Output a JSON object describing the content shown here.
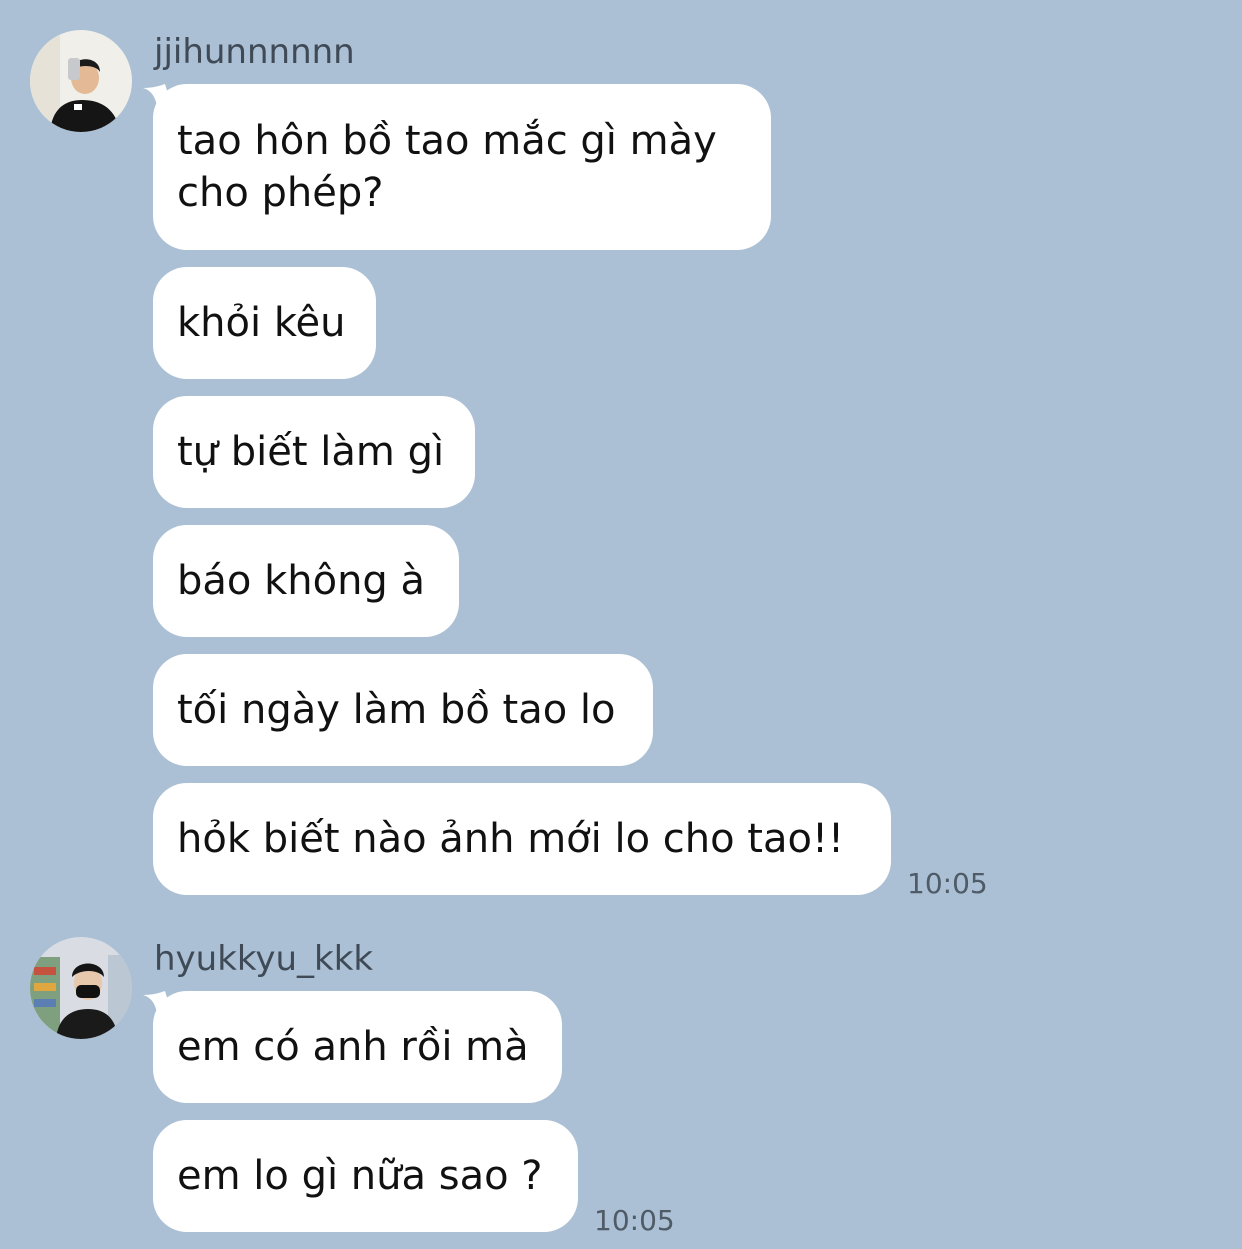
{
  "chat": {
    "groups": [
      {
        "username": "jjihunnnnnn",
        "avatar": "avatar-selfie-white-room",
        "messages": [
          "tao hôn bồ tao mắc gì mày cho phép?",
          "khỏi kêu",
          "tự biết làm gì",
          "báo không à",
          "tối ngày làm bồ tao lo",
          "hỏk biết nào ảnh mới lo cho tao!!"
        ],
        "time": "10:05"
      },
      {
        "username": "hyukkyu_kkk",
        "avatar": "avatar-masked-in-store",
        "messages": [
          "em có anh rồi mà",
          "em lo gì nữa sao ?"
        ],
        "time": "10:05"
      }
    ]
  },
  "colors": {
    "background": "#abc0d4",
    "bubble": "#ffffff",
    "text": "#111111",
    "username": "#3f4a56",
    "timestamp": "#4f5b66"
  }
}
